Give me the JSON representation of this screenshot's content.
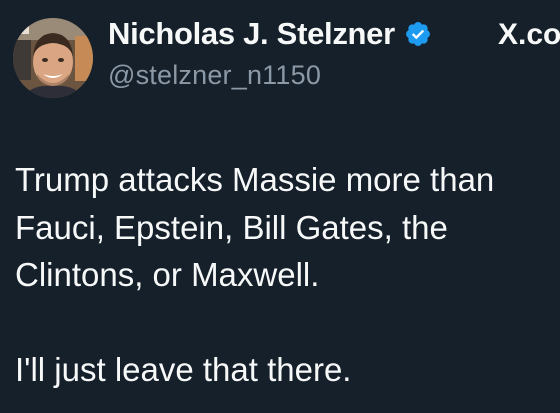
{
  "author": {
    "display_name": "Nicholas J. Stelzner",
    "handle": "@stelzner_n1150",
    "verified_icon": "verified-badge-icon",
    "avatar": "profile-photo"
  },
  "brand": {
    "text": "X.co",
    "icon": "x-logo"
  },
  "tweet": {
    "line1": "Trump attacks Massie more than",
    "line2": "Fauci, Epstein, Bill Gates, the",
    "line3": "Clintons, or Maxwell.",
    "line4": "I'll just leave that there."
  },
  "colors": {
    "background": "#15202b",
    "text": "#f7f9f9",
    "secondary_text": "#8b98a5",
    "verified_blue": "#1d9bf0"
  }
}
